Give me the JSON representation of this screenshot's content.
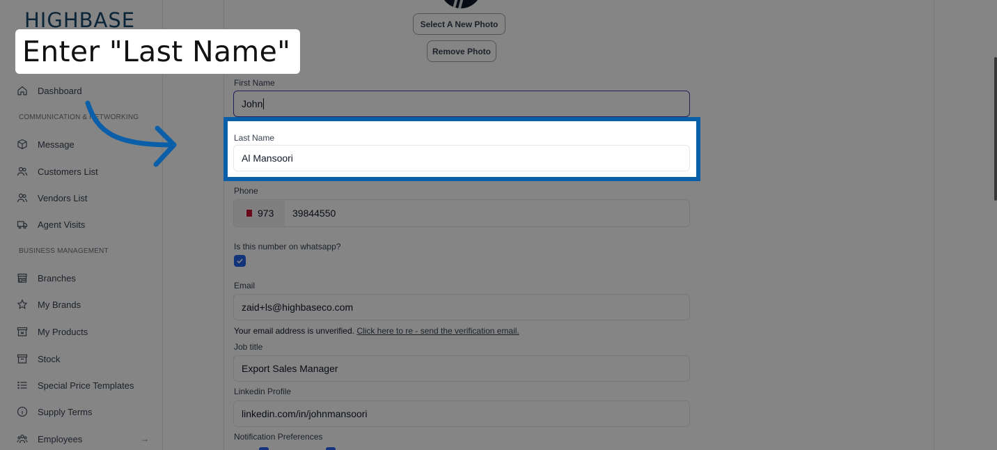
{
  "brand": {
    "logo_text": "HIGHBASE"
  },
  "sidebar": {
    "items": [
      {
        "label": "Dashboard",
        "icon": "home-icon"
      },
      {
        "label": "Message",
        "icon": "cube-icon"
      },
      {
        "label": "Customers List",
        "icon": "users-icon"
      },
      {
        "label": "Vendors List",
        "icon": "users-icon"
      },
      {
        "label": "Agent Visits",
        "icon": "truck-icon"
      },
      {
        "label": "Branches",
        "icon": "store-icon"
      },
      {
        "label": "My Brands",
        "icon": "star-icon"
      },
      {
        "label": "My Products",
        "icon": "box-icon"
      },
      {
        "label": "Stock",
        "icon": "archive-icon"
      },
      {
        "label": "Special Price Templates",
        "icon": "list-icon"
      },
      {
        "label": "Supply Terms",
        "icon": "info-icon"
      },
      {
        "label": "Employees",
        "icon": "team-icon",
        "chevron": "→"
      }
    ],
    "sections": [
      "COMMUNICATION & NETWORKING",
      "BUSINESS MANAGEMENT"
    ]
  },
  "profile": {
    "select_photo_label": "Select A New Photo",
    "remove_photo_label": "Remove Photo",
    "first_name": {
      "label": "First Name",
      "value": "John"
    },
    "last_name": {
      "label": "Last Name",
      "value": "Al Mansoori"
    },
    "phone": {
      "label": "Phone",
      "country_code": "973",
      "number": "39844550"
    },
    "whatsapp": {
      "label": "Is this number on whatsapp?",
      "checked": true
    },
    "email": {
      "label": "Email",
      "value": "zaid+ls@highbaseco.com",
      "helper_text": "Your email address is unverified.",
      "helper_link": "Click here to re - send the verification email."
    },
    "job_title": {
      "label": "Job title",
      "value": "Export Sales Manager"
    },
    "linkedin": {
      "label": "Linkedin Profile",
      "value": "linkedin.com/in/johnmansoori"
    },
    "notifications": {
      "label": "Notification Preferences"
    }
  },
  "tutorial": {
    "callout_text": "Enter \"Last Name\"",
    "highlight_color": "#0b5ea8"
  }
}
